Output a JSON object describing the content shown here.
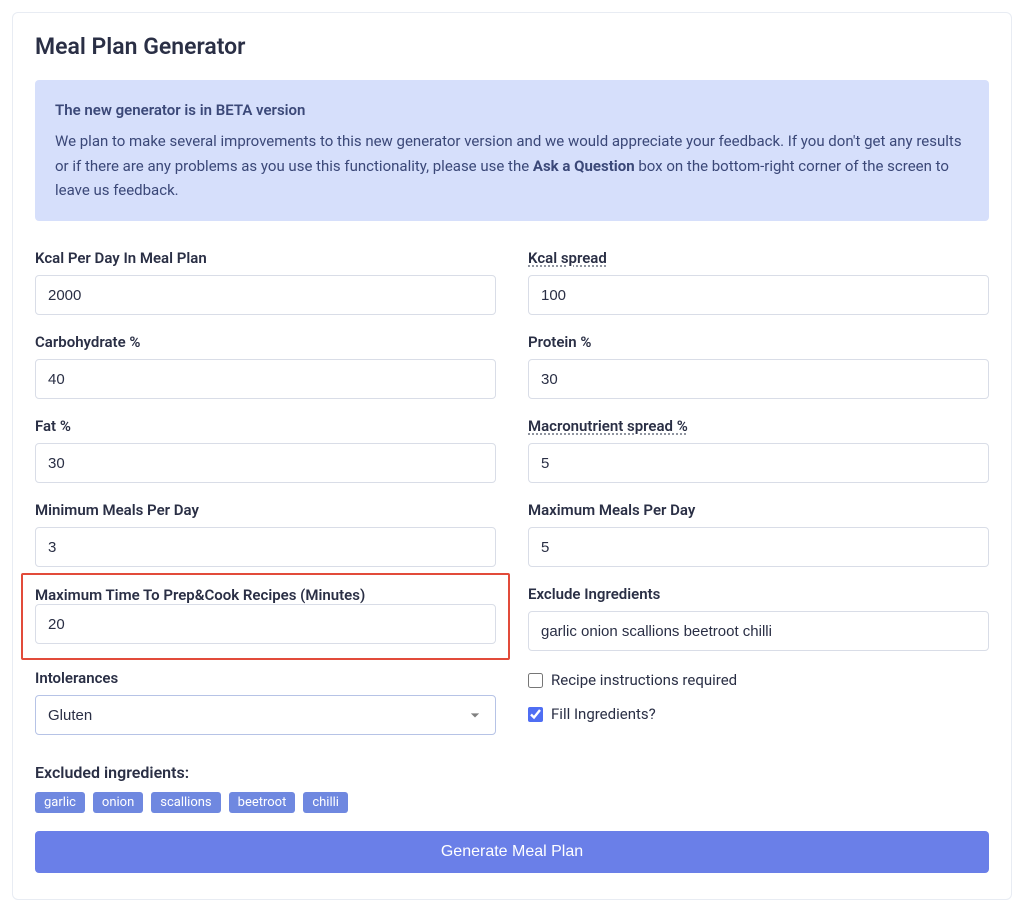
{
  "title": "Meal Plan Generator",
  "banner": {
    "title": "The new generator is in BETA version",
    "body_before": "We plan to make several improvements to this new generator version and we would appreciate your feedback. If you don't get any results or if there are any problems as you use this functionality, please use the ",
    "body_strong": "Ask a Question",
    "body_after": " box on the bottom-right corner of the screen to leave us feedback."
  },
  "fields": {
    "kcal_per_day": {
      "label": "Kcal Per Day In Meal Plan",
      "value": "2000"
    },
    "kcal_spread": {
      "label": "Kcal spread",
      "value": "100"
    },
    "carbohydrate": {
      "label": "Carbohydrate %",
      "value": "40"
    },
    "protein": {
      "label": "Protein %",
      "value": "30"
    },
    "fat": {
      "label": "Fat %",
      "value": "30"
    },
    "macro_spread": {
      "label": "Macronutrient spread %",
      "value": "5"
    },
    "min_meals": {
      "label": "Minimum Meals Per Day",
      "value": "3"
    },
    "max_meals": {
      "label": "Maximum Meals Per Day",
      "value": "5"
    },
    "max_prep_time": {
      "label": "Maximum Time To Prep&Cook Recipes (Minutes)",
      "value": "20"
    },
    "exclude_ingredients": {
      "label": "Exclude Ingredients",
      "value": "garlic onion scallions beetroot chilli"
    },
    "intolerances": {
      "label": "Intolerances",
      "value": "Gluten"
    }
  },
  "checkboxes": {
    "recipe_instructions": {
      "label": "Recipe instructions required",
      "checked": false
    },
    "fill_ingredients": {
      "label": "Fill Ingredients?",
      "checked": true
    }
  },
  "excluded": {
    "title": "Excluded ingredients:",
    "tags": [
      "garlic",
      "onion",
      "scallions",
      "beetroot",
      "chilli"
    ]
  },
  "generate_label": "Generate Meal Plan"
}
